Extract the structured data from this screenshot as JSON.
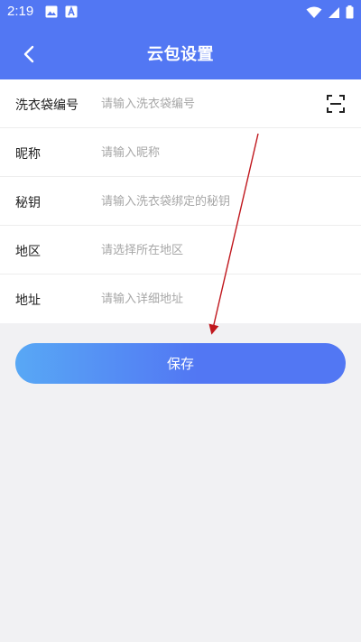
{
  "status_bar": {
    "time": "2:19",
    "left_icons": [
      "gallery-icon",
      "font-icon"
    ],
    "right_icons": [
      "wifi-icon",
      "signal-icon",
      "battery-icon"
    ]
  },
  "header": {
    "title": "云包设置",
    "back_icon": "back-arrow-icon"
  },
  "form": {
    "rows": [
      {
        "label": "洗衣袋编号",
        "placeholder": "请输入洗衣袋编号",
        "icon": "scan-icon"
      },
      {
        "label": "昵称",
        "placeholder": "请输入昵称"
      },
      {
        "label": "秘钥",
        "placeholder": "请输入洗衣袋绑定的秘钥"
      },
      {
        "label": "地区",
        "placeholder": "请选择所在地区"
      },
      {
        "label": "地址",
        "placeholder": "请输入详细地址"
      }
    ]
  },
  "actions": {
    "save_label": "保存"
  },
  "colors": {
    "primary": "#5277f3",
    "gradient_start": "#58a8f5",
    "annotation_arrow": "#c0171d"
  }
}
